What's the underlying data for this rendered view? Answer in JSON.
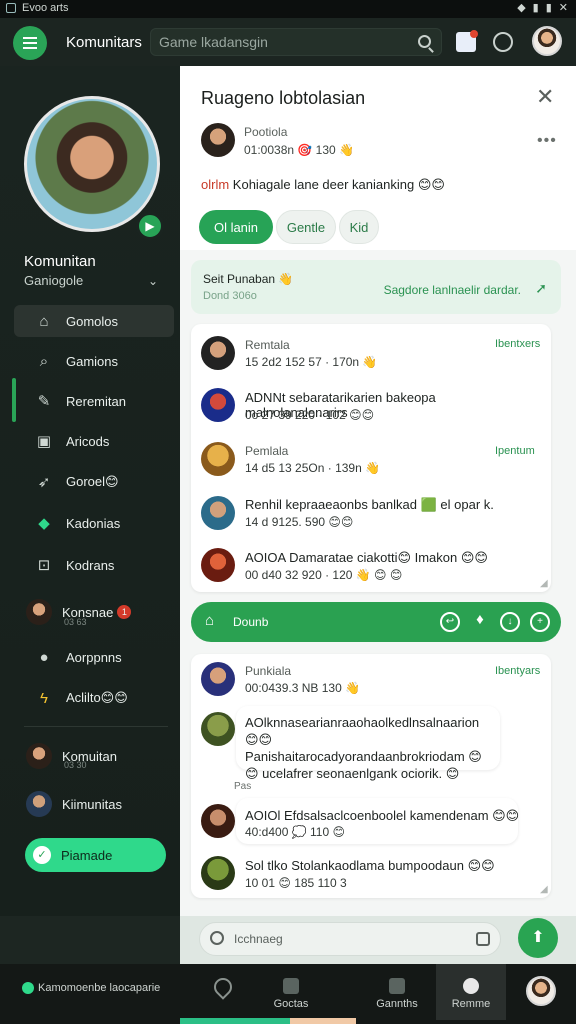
{
  "status": {
    "left": "Evoo arts",
    "right": "✕"
  },
  "topbar": {
    "title": "Komunitars",
    "search_placeholder": "Game lkadansgin"
  },
  "sidebar": {
    "name": "Komunitan",
    "subtitle": "Ganiogole",
    "items": [
      {
        "label": "Gomolos",
        "icon": "home-icon"
      },
      {
        "label": "Gamions",
        "icon": "search-icon"
      },
      {
        "label": "Reremitan",
        "icon": "bell-icon"
      },
      {
        "label": "Aricods",
        "icon": "monitor-icon"
      },
      {
        "label": "Goroel😊",
        "icon": "rocket-icon"
      },
      {
        "label": "Kadonias",
        "icon": "gamepad-icon"
      },
      {
        "label": "Kodrans",
        "icon": "box-icon"
      },
      {
        "label": "Konsnae",
        "icon": "user-avatar",
        "badge": "1",
        "sub": "03 63"
      },
      {
        "label": "Aorppnns",
        "icon": "person-icon"
      },
      {
        "label": "Aclilto😊😊",
        "icon": "lightning-icon"
      }
    ],
    "users": [
      {
        "name": "Komuitan",
        "sub": "03 30"
      },
      {
        "name": "Kiimunitas",
        "sub": ""
      }
    ],
    "promo": "Piamade"
  },
  "header": {
    "title": "Ruageno lobtolasian",
    "poster": "Pootiola",
    "meta": "01:0038n 🎯 130 👋",
    "text_prefix": "olrlm",
    "text": "Kohiagale lane deer kanianking 😊😊",
    "chips": [
      "Ol lanin",
      "Gentle",
      "Kid"
    ]
  },
  "pinned": {
    "title": "Seit Punaban 👋",
    "sub": "Dond 306o",
    "action": "Sagdore lanlnaelir dardar."
  },
  "cards": [
    {
      "messages": [
        {
          "name": "Remtala",
          "meta": "15 2d2 152 57 · 170n 👋",
          "tag": "Ibentxers"
        },
        {
          "text": "ADNNt sebaratarikarien bakeopa malnolanalenarirs",
          "meta": "0o 27 39 220 · 102 😊😊"
        },
        {
          "name": "Pemlala",
          "meta": "14 d5 13 25On · 139n 👋",
          "tag": "Ipentum"
        },
        {
          "text": "Renhil kepraaeaonbs banlkad 🟩 el opar k.",
          "meta": "14 d 9125. 590 😊😊"
        },
        {
          "text": "AOIOA Damaratae ciakotti😊 Imakon 😊😊",
          "meta": "00 d40 32 920 · 120 👋   😊  😊"
        }
      ]
    },
    {
      "messages": [
        {
          "name": "Punkiala",
          "meta": "00:0439.3 NB 130 👋",
          "tag": "Ibentyars"
        },
        {
          "text": "AOlknnasearianraaohaolkedlnsalnaarion 😊😊 Panishaitarocadyorandaanbrokriodam 😊😊 ucelafrer seonaenlgank ociorik. 😊",
          "meta": "Pas"
        },
        {
          "text": "AOIOl Efdsalsaclcoenboolel kamendenam 😊😊",
          "meta": "40:d400 💭 110 😊"
        },
        {
          "text": "Sol tlko Stolankaodlama bumpoodaun 😊😊",
          "meta": "10 01 😊 185 110 3"
        }
      ]
    }
  ],
  "greenbar": {
    "label": "Dounb"
  },
  "input": {
    "placeholder": "Icchnaeg"
  },
  "bottom": {
    "left_text": "Kamomoenbe laocaparie",
    "tabs": [
      "Goctas",
      "Gannths",
      "Remme"
    ]
  },
  "colors": {
    "accent": "#2aa457",
    "sidebar": "#1a2420",
    "content": "#f4f6f5"
  }
}
